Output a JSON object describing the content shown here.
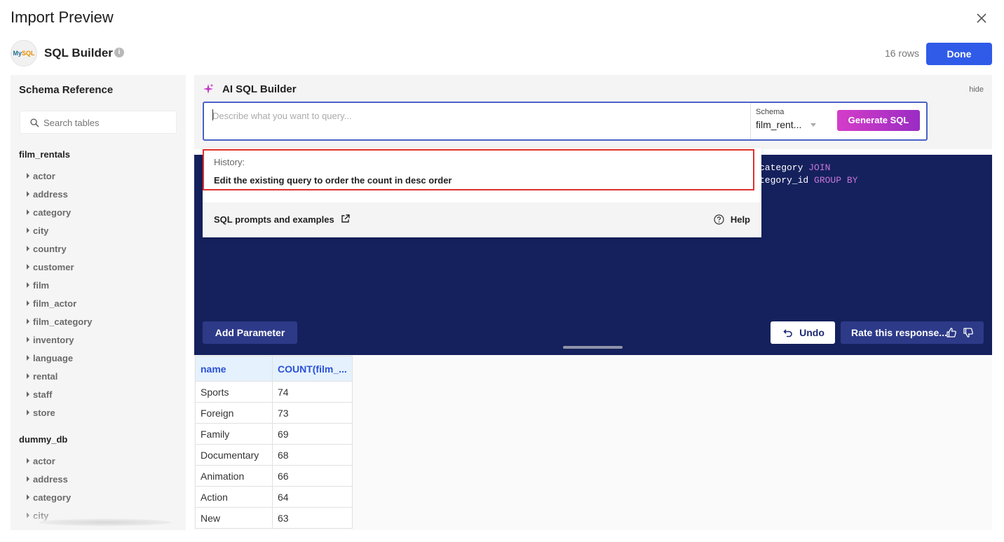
{
  "dialog": {
    "title": "Import Preview"
  },
  "header": {
    "builder_title": "SQL Builder",
    "logo_text_my": "My",
    "logo_text_sql": "SQL",
    "rows": "16 rows",
    "done_label": "Done"
  },
  "schema_panel": {
    "title": "Schema Reference",
    "search_placeholder": "Search tables",
    "databases": [
      {
        "name": "film_rentals",
        "tables": [
          "actor",
          "address",
          "category",
          "city",
          "country",
          "customer",
          "film",
          "film_actor",
          "film_category",
          "inventory",
          "language",
          "rental",
          "staff",
          "store"
        ]
      },
      {
        "name": "dummy_db",
        "tables": [
          "actor",
          "address",
          "category",
          "city"
        ]
      }
    ]
  },
  "ai_builder": {
    "title": "AI SQL Builder",
    "hide_label": "hide",
    "prompt_placeholder": "Describe what you want to query...",
    "schema_label": "Schema",
    "schema_value": "film_rent...",
    "generate_label": "Generate SQL"
  },
  "history": {
    "label": "History:",
    "items": [
      "Edit the existing query to order the count in desc order"
    ],
    "prompts_link": "SQL prompts and examples",
    "help_label": "Help"
  },
  "editor": {
    "line1_text": "category ",
    "line1_kw": "JOIN",
    "line2_text": "tegory_id ",
    "line2_kw": "GROUP BY",
    "add_parameter_label": "Add Parameter",
    "undo_label": "Undo",
    "rate_label": "Rate this response..."
  },
  "results": {
    "columns": [
      "name",
      "COUNT(film_..."
    ],
    "rows": [
      [
        "Sports",
        "74"
      ],
      [
        "Foreign",
        "73"
      ],
      [
        "Family",
        "69"
      ],
      [
        "Documentary",
        "68"
      ],
      [
        "Animation",
        "66"
      ],
      [
        "Action",
        "64"
      ],
      [
        "New",
        "63"
      ]
    ]
  },
  "colors": {
    "accent": "#2f5be8",
    "editor_bg": "#15215d",
    "generate_start": "#d43dc8",
    "generate_end": "#9a2cc3",
    "history_border": "#e0312f"
  }
}
